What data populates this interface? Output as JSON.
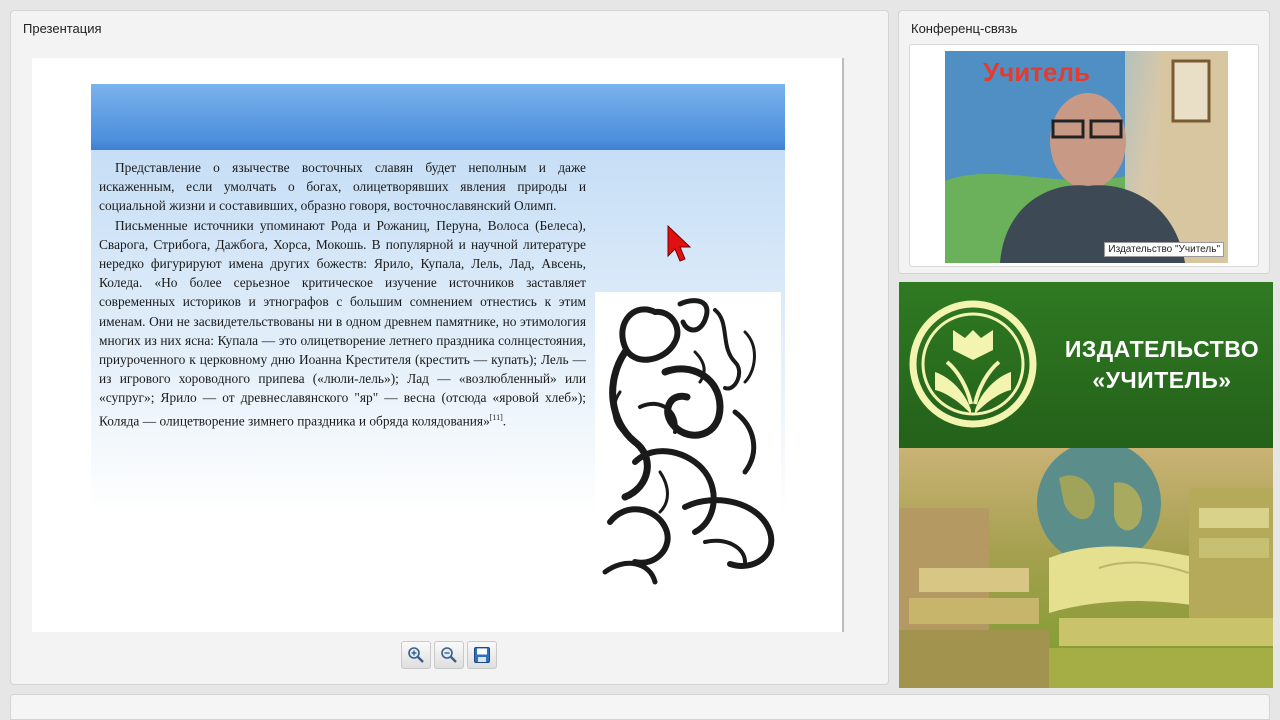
{
  "presentation": {
    "title": "Презентация",
    "paragraph1": "Представление о язычестве восточных славян будет неполным и даже искаженным, если умолчать о богах, олицетворявших явления природы и социальной жизни и составивших, образно говоря, восточнославянский Олимп.",
    "paragraph2": "Письменные источники упоминают Рода и Рожаниц, Перуна, Волоса (Белеса), Сварога, Стрибога, Дажбога, Хорса, Мокошь. В популярной и научной литературе нередко фигурируют имена других божеств: Ярило, Купала, Лель, Лад, Авсень, Коледа. «Но более серьезное критическое изучение источников заставляет современных историков и этнографов с большим сомнением отнестись к этим именам. Они не засвидетельствованы ни в одном древнем памятнике, но этимология многих из них ясна: Купала — это олицетворение летнего праздника солнцестояния, приуроченного к церковному дню Иоанна Крестителя (крестить — купать); Лель — из игрового хороводного припева («люли-лель»); Лад — «возлюбленный» или «супруг»; Ярило — от древнеславянского \"яр\" — весна (отсюда «яровой хлеб»); Коляда — олицетворение зимнего праздника и обряда колядования»",
    "footnote": "[11]",
    "footnote_tail": ".",
    "toolbar": {
      "zoom_in_icon": "zoom-in-icon",
      "zoom_out_icon": "zoom-out-icon",
      "save_icon": "save-icon"
    }
  },
  "conference": {
    "title": "Конференц-связь",
    "video_label": "Издательство \"Учитель\""
  },
  "brand": {
    "line1": "ИЗДАТЕЛЬСТВО",
    "line2": "«УЧИТЕЛЬ»",
    "colors": {
      "green": "#2f7a22",
      "accent": "#f0f3a0"
    }
  }
}
